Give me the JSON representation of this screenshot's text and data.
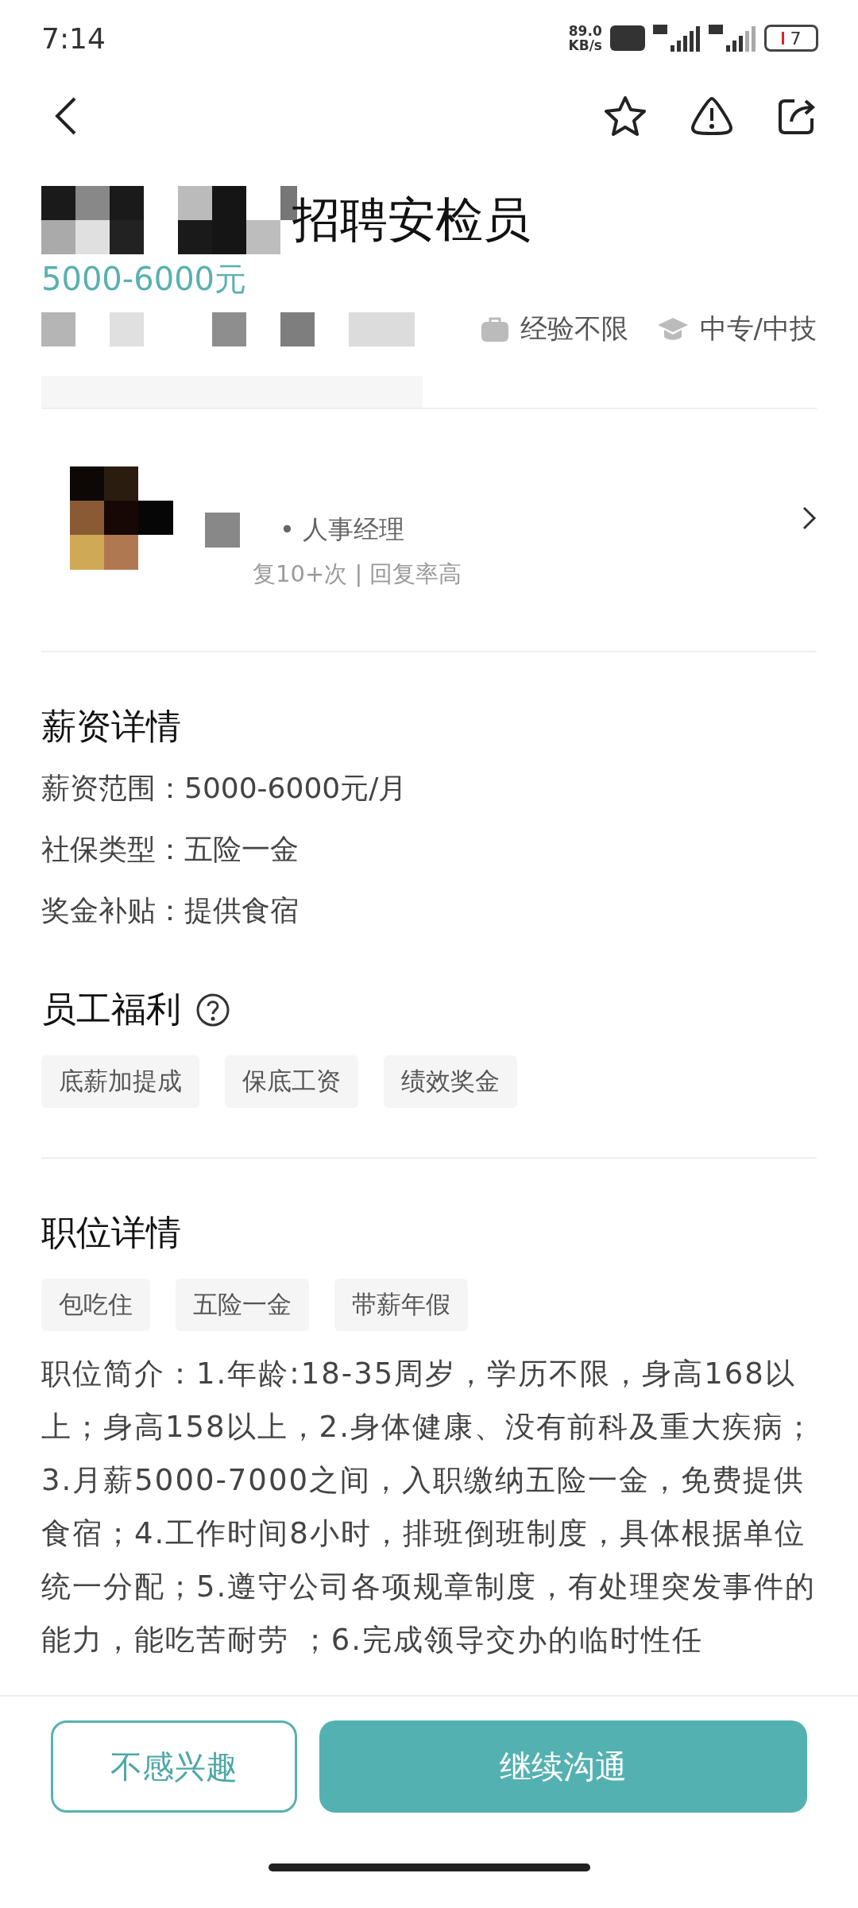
{
  "status_bar": {
    "time": "7:14",
    "speed": "89.0",
    "speed_unit": "KB/s",
    "battery": "7"
  },
  "job": {
    "title": "招聘安检员",
    "salary": "5000-6000元",
    "requirements": [
      {
        "kind": "experience",
        "text": "经验不限"
      },
      {
        "kind": "education",
        "text": "中专/中技"
      }
    ]
  },
  "recruiter": {
    "role": "• 人事经理",
    "activity": "复10+次 | 回复率高"
  },
  "salary_details": {
    "heading": "薪资详情",
    "rows": [
      "薪资范围：5000-6000元/月",
      "社保类型：五险一金",
      "奖金补贴：提供食宿"
    ]
  },
  "benefits": {
    "heading": "员工福利",
    "tags": [
      "底薪加提成",
      "保底工资",
      "绩效奖金"
    ]
  },
  "position": {
    "heading": "职位详情",
    "tags": [
      "包吃住",
      "五险一金",
      "带薪年假"
    ],
    "description": "职位简介：1.年龄:18-35周岁，学历不限，身高168以上；身高158以上，2.身体健康、没有前科及重大疾病；3.月薪5000-7000之间，入职缴纳五险一金，免费提供食宿；4.工作时间8小时，排班倒班制度，具体根据单位统一分配；5.遵守公司各项规章制度，有处理突发事件的能力，能吃苦耐劳 ；6.完成领导交办的临时性任"
  },
  "buttons": [
    {
      "kind": "secondary",
      "label": "不感兴趣"
    },
    {
      "kind": "primary",
      "label": "继续沟通"
    }
  ]
}
